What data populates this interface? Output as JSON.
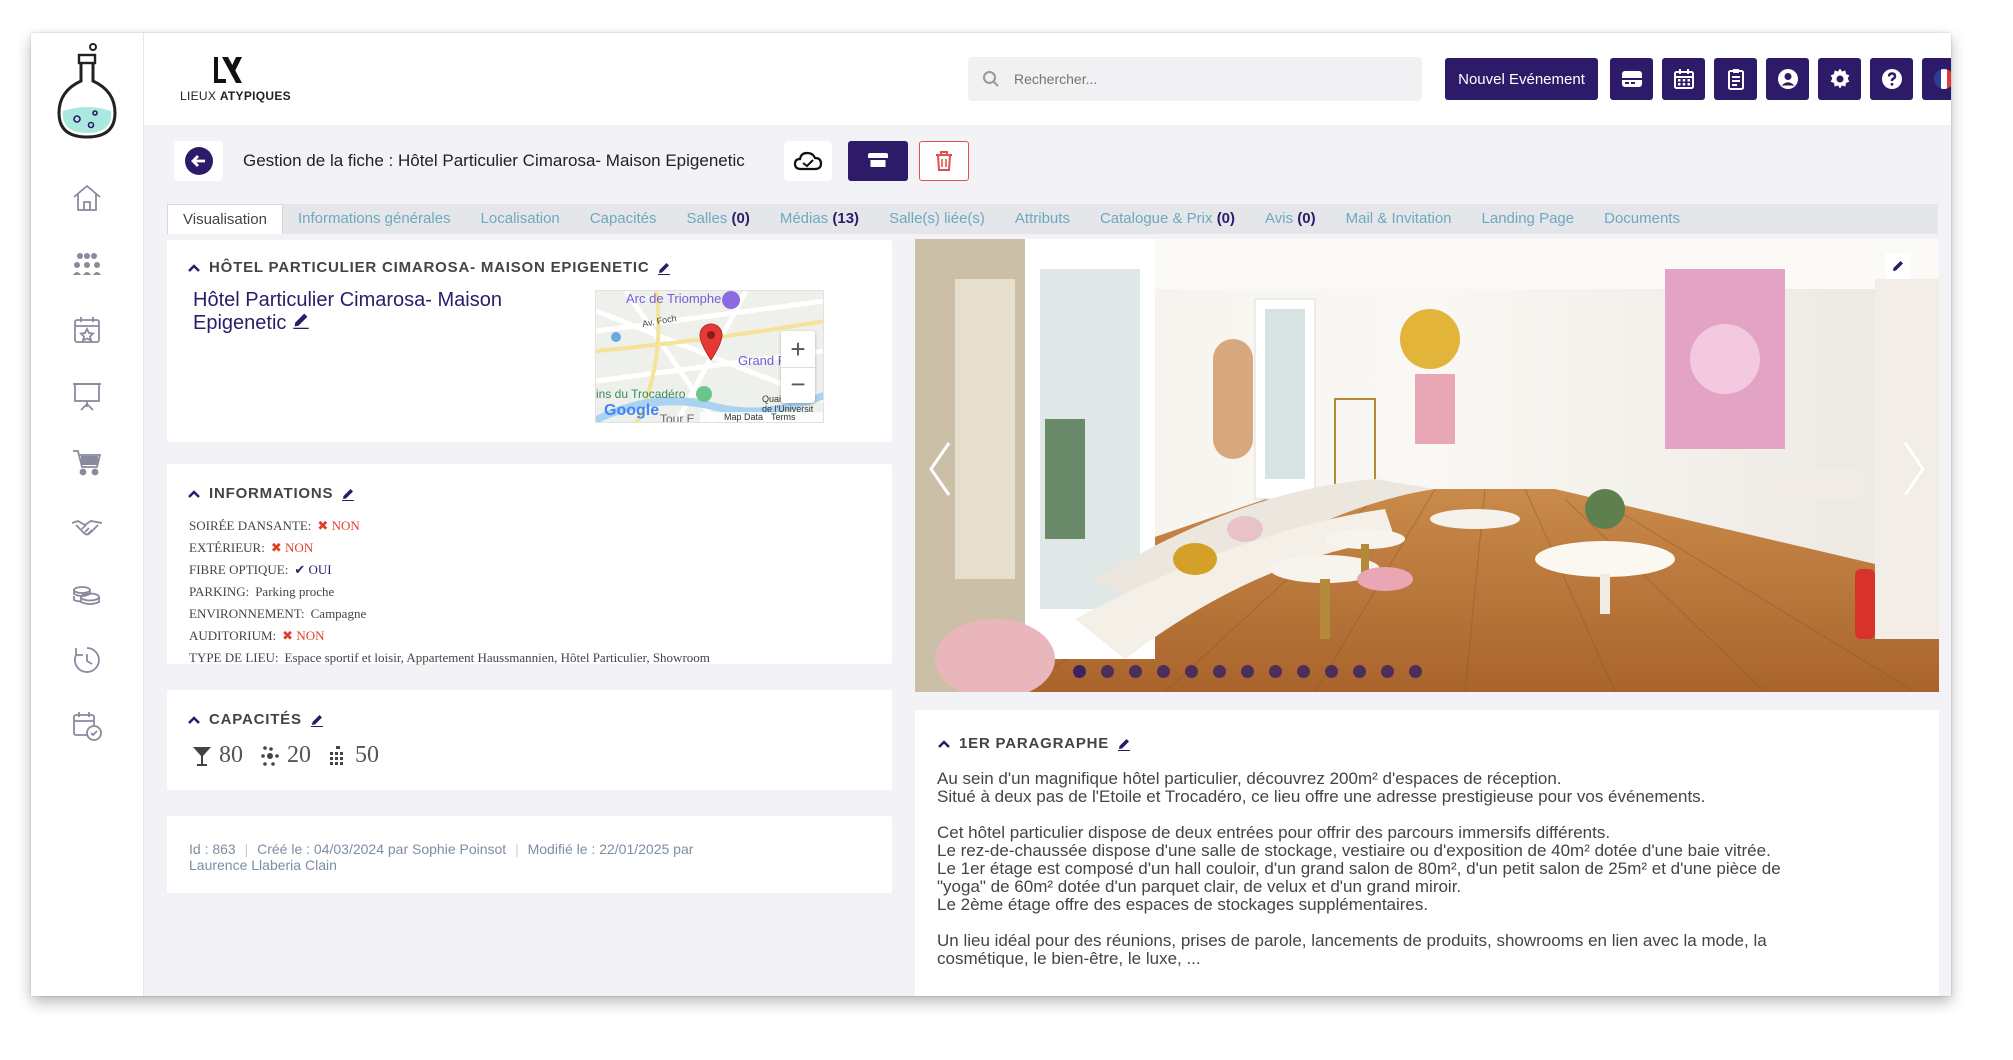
{
  "brand": {
    "name_light": "LIEUX ",
    "name_bold": "ATYPIQUES"
  },
  "search": {
    "placeholder": "Rechercher..."
  },
  "toolbar": {
    "new_event_label": "Nouvel Evénement",
    "icons": [
      "card-icon",
      "calendar-icon",
      "clipboard-icon",
      "user-circle-icon",
      "gear-icon",
      "help-icon",
      "flag-fr-icon"
    ]
  },
  "sidebar": {
    "items": [
      "home-icon",
      "team-icon",
      "calendar-star-icon",
      "presentation-icon",
      "cart-icon",
      "handshake-icon",
      "coins-icon",
      "clock-cycle-icon",
      "calendar-check-icon"
    ]
  },
  "header": {
    "title": "Gestion de la fiche : Hôtel Particulier Cimarosa- Maison Epigenetic"
  },
  "tabs": [
    {
      "label": "Visualisation",
      "count": ""
    },
    {
      "label": "Informations générales",
      "count": ""
    },
    {
      "label": "Localisation",
      "count": ""
    },
    {
      "label": "Capacités",
      "count": ""
    },
    {
      "label": "Salles",
      "count": "(0)"
    },
    {
      "label": "Médias",
      "count": "(13)"
    },
    {
      "label": "Salle(s) liée(s)",
      "count": ""
    },
    {
      "label": "Attributs",
      "count": ""
    },
    {
      "label": "Catalogue & Prix",
      "count": "(0)"
    },
    {
      "label": "Avis",
      "count": "(0)"
    },
    {
      "label": "Mail & Invitation",
      "count": ""
    },
    {
      "label": "Landing Page",
      "count": ""
    },
    {
      "label": "Documents",
      "count": ""
    }
  ],
  "venue": {
    "section_title": "HÔTEL PARTICULIER CIMAROSA- MAISON EPIGENETIC",
    "name": "Hôtel Particulier Cimarosa- Maison Epigenetic",
    "map": {
      "labels": [
        "Arc de Triomphe",
        "Av. Foch",
        "Grand P",
        "ins du Trocadéro",
        "Quai de",
        "de l'Universit",
        "Tour E"
      ],
      "google": "Google",
      "map_data": "Map Data",
      "terms": "Terms"
    }
  },
  "informations": {
    "title": "INFORMATIONS",
    "rows": [
      {
        "key": "SOIRÉE DANSANTE:",
        "value": "NON",
        "kind": "no"
      },
      {
        "key": "EXTÉRIEUR:",
        "value": "NON",
        "kind": "no"
      },
      {
        "key": "FIBRE OPTIQUE:",
        "value": "OUI",
        "kind": "yes"
      },
      {
        "key": "PARKING:",
        "value": "Parking proche",
        "kind": "text"
      },
      {
        "key": "ENVIRONNEMENT:",
        "value": "Campagne",
        "kind": "text"
      },
      {
        "key": "AUDITORIUM:",
        "value": "NON",
        "kind": "no"
      },
      {
        "key": "TYPE DE LIEU:",
        "value": "Espace sportif et loisir, Appartement Haussmannien, Hôtel Particulier, Showroom",
        "kind": "text"
      }
    ]
  },
  "capacites": {
    "title": "CAPACITÉS",
    "cocktail": "80",
    "banquet": "20",
    "theatre": "50"
  },
  "meta": {
    "id": "Id : 863",
    "created": "Créé le : 04/03/2024 par Sophie Poinsot",
    "modified": "Modifié le : 22/01/2025 par Laurence Llaberia Clain"
  },
  "gallery": {
    "total": 13,
    "current": 1
  },
  "paragraph": {
    "title": "1ER PARAGRAPHE",
    "lines": [
      "Au sein d'un magnifique hôtel particulier, découvrez 200m² d'espaces de réception.",
      "Situé à deux pas de l'Etoile et Trocadéro, ce lieu offre une adresse prestigieuse pour vos événements.",
      "",
      "Cet hôtel particulier dispose de deux entrées pour offrir des parcours immersifs différents.",
      "Le rez-de-chaussée dispose d'une salle de stockage, vestiaire ou d'exposition de 40m² dotée d'une baie vitrée.",
      "Le 1er étage est composé d'un hall couloir, d'un grand salon de 80m², d'un petit salon de 25m² et d'une pièce de",
      "\"yoga\" de 60m² dotée d'un parquet clair, de velux et d'un grand miroir.",
      "Le 2ème étage offre des espaces de stockages supplémentaires.",
      "",
      "Un lieu idéal pour des réunions, prises de parole, lancements de produits, showrooms en lien avec la mode, la",
      "cosmétique, le bien-être, le luxe, ..."
    ]
  },
  "colors": {
    "primary": "#2d1b69",
    "tab_text": "#6fa8c0",
    "danger": "#e0402a"
  }
}
